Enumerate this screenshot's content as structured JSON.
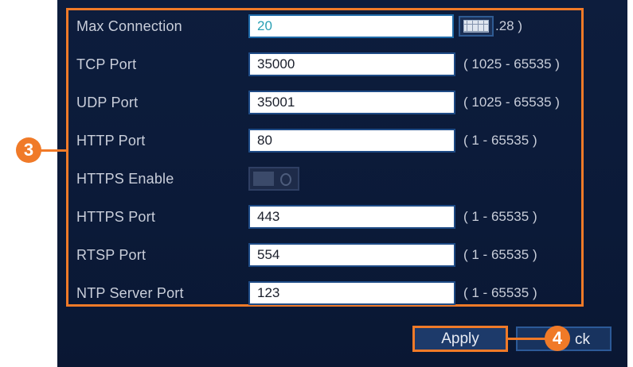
{
  "settings": {
    "rows": [
      {
        "label": "Max Connection",
        "value": "20",
        "range": ".28 )"
      },
      {
        "label": "TCP Port",
        "value": "35000",
        "range": "( 1025 - 65535 )"
      },
      {
        "label": "UDP Port",
        "value": "35001",
        "range": "( 1025 - 65535 )"
      },
      {
        "label": "HTTP Port",
        "value": "80",
        "range": "( 1 - 65535 )"
      },
      {
        "label": "HTTPS Enable",
        "toggle": "off"
      },
      {
        "label": "HTTPS Port",
        "value": "443",
        "range": "( 1 - 65535 )"
      },
      {
        "label": "RTSP Port",
        "value": "554",
        "range": "( 1 - 65535 )"
      },
      {
        "label": "NTP Server Port",
        "value": "123",
        "range": "( 1 - 65535 )"
      }
    ]
  },
  "buttons": {
    "apply": "Apply",
    "back_partial": "ck"
  },
  "callouts": {
    "settings": "3",
    "apply": "4"
  },
  "icons": {
    "keyboard": "keyboard-icon"
  },
  "colors": {
    "accent": "#f07a28",
    "panel_bg": "#0d1d3d",
    "field_bg": "#ffffff",
    "active_value": "#2aa0b4"
  }
}
